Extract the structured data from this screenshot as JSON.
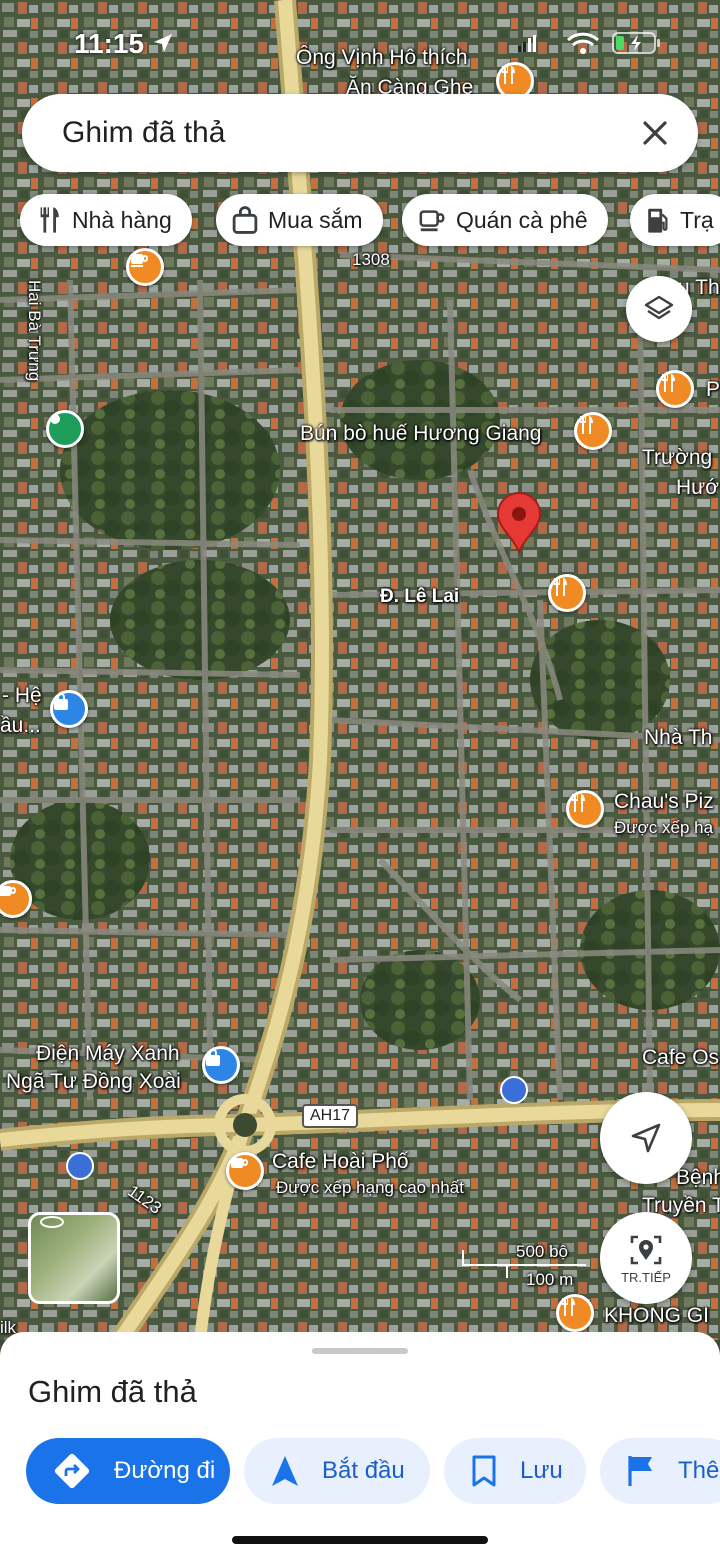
{
  "status_bar": {
    "time": "11:15"
  },
  "search": {
    "text": "Ghim đã thả"
  },
  "chips": [
    {
      "label": "Nhà hàng",
      "icon": "restaurant-icon"
    },
    {
      "label": "Mua sắm",
      "icon": "shopping-bag-icon"
    },
    {
      "label": "Quán cà phê",
      "icon": "coffee-icon"
    },
    {
      "label": "Trạ",
      "icon": "gas-station-icon"
    }
  ],
  "map": {
    "labels": {
      "place_top": "Ông Vịnh Hô thích",
      "place_top2": "Ăn Càng Ghe",
      "road_1308": "1308",
      "street_left": "Hai Bà Trưng",
      "bun_bo": "Bún bò huế Hương Giang",
      "truong": "Trường",
      "huo": "Hướ",
      "p_right": "P",
      "u_th": "u Th",
      "le_lai": "Đ. Lê Lai",
      "he": "- Hệ",
      "dau": "ầu...",
      "nha_th": "Nhà Th",
      "chaus": "Chau's Piz",
      "chaus_sub": "Được xếp hạ",
      "dien_may_1": "Điện Máy Xanh",
      "dien_may_2": "Ngã Tư Đồng Xoài",
      "cafe_os": "Cafe Os",
      "ah17": "AH17",
      "cafe_hoai_pho": "Cafe Hoài Phố",
      "cafe_hoai_sub": "Được xếp hạng cao nhất",
      "road_1123": "1123",
      "benh": "Bệnh",
      "truyen": "Truyền T",
      "khong_gi": "KHONG GI",
      "ilk": "ilk"
    },
    "scale": {
      "imperial": "500 bộ",
      "metric": "100 m"
    },
    "next_button": "TR.TIẾP",
    "pin_color": "#e53935",
    "poi_orange": "#f08a24",
    "poi_blue": "#2d86e6"
  },
  "sheet": {
    "title": "Ghim đã thả",
    "actions": [
      {
        "label": "Đường đi",
        "icon": "directions-icon"
      },
      {
        "label": "Bắt đầu",
        "icon": "navigation-arrow-icon"
      },
      {
        "label": "Lưu",
        "icon": "bookmark-icon"
      },
      {
        "label": "Thêm",
        "icon": "flag-icon"
      }
    ]
  },
  "colors": {
    "accent": "#1a73e8",
    "accent_light": "#e8f0fe",
    "road_major": "#e8d89a"
  }
}
